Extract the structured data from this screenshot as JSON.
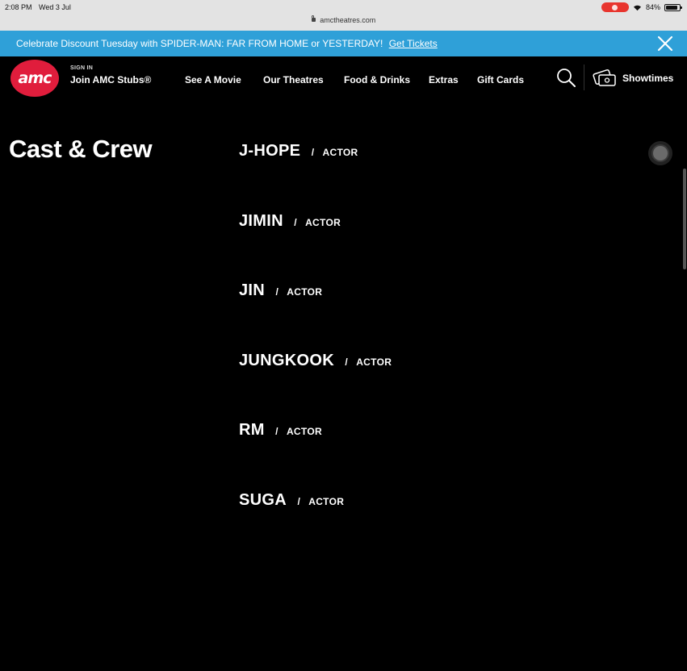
{
  "status_bar": {
    "time": "2:08 PM",
    "date": "Wed 3 Jul",
    "url": "amctheatres.com",
    "battery": "84%"
  },
  "banner": {
    "text": "Celebrate Discount Tuesday with SPIDER-MAN: FAR FROM HOME or YESTERDAY!",
    "link": "Get Tickets",
    "color": "#2fa0d8"
  },
  "header": {
    "logo": "amc",
    "logo_color": "#e01d3c",
    "sign_in": "SIGN IN",
    "join": "Join AMC Stubs®",
    "nav": [
      {
        "label": "See A Movie"
      },
      {
        "label": "Our Theatres"
      },
      {
        "label": "Food & Drinks"
      },
      {
        "label": "Extras"
      },
      {
        "label": "Gift Cards"
      }
    ],
    "search_icon": "search-icon",
    "showtimes_icon": "tickets-icon",
    "showtimes_label": "Showtimes"
  },
  "main": {
    "title": "Cast & Crew",
    "separator": "/",
    "cast": [
      {
        "name": "J-HOPE",
        "role": "ACTOR"
      },
      {
        "name": "JIMIN",
        "role": "ACTOR"
      },
      {
        "name": "JIN",
        "role": "ACTOR"
      },
      {
        "name": "JUNGKOOK",
        "role": "ACTOR"
      },
      {
        "name": "RM",
        "role": "ACTOR"
      },
      {
        "name": "SUGA",
        "role": "ACTOR"
      }
    ]
  }
}
